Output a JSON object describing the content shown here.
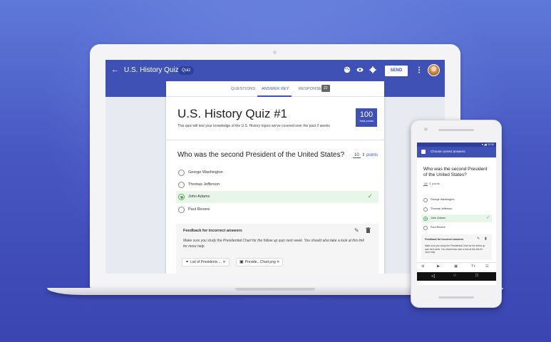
{
  "appbar": {
    "back_icon": "←",
    "title": "U.S. History Quiz #1",
    "chip": "Quiz",
    "send_label": "SEND",
    "icons": [
      "palette-icon",
      "eye-icon",
      "gear-icon",
      "more-vert-icon"
    ]
  },
  "tabs": {
    "questions": "QUESTIONS",
    "answer_key": "ANSWER KEY",
    "responses": "RESPONSES",
    "responses_count": "22"
  },
  "quiz": {
    "title": "U.S. History Quiz #1",
    "description": "This quiz will test your knowledge of the U.S. History topics we've covered over the past 2 weeks",
    "total_points": "100",
    "total_points_label": "Total points"
  },
  "question": {
    "text": "Who was the second President of the United States?",
    "points_value": "10",
    "points_label": "points",
    "options": [
      {
        "label": "George Washington",
        "selected": false
      },
      {
        "label": "Thomas Jefferson",
        "selected": false
      },
      {
        "label": "John Adams",
        "selected": true
      },
      {
        "label": "Paul Revere",
        "selected": false
      }
    ]
  },
  "feedback": {
    "title": "Feedback for incorrect answers",
    "text": "Make sure you study the Presidential Chart for the follow up quiz next week. You should also take a look at this link for more help.",
    "chips": [
      {
        "icon": "link-icon",
        "label": "List of Presidents ..."
      },
      {
        "icon": "image-icon",
        "label": "Preside...Chart.png"
      }
    ]
  },
  "phone": {
    "status_time": "12:30",
    "bar_title": "Choose correct answers",
    "question_text": "Who was the second President of the United States?",
    "points_value": "10",
    "points_label": "points",
    "options": [
      {
        "label": "George Washington",
        "selected": false
      },
      {
        "label": "Thomas Jefferson",
        "selected": false
      },
      {
        "label": "John Adams",
        "selected": true
      },
      {
        "label": "Paul Revere",
        "selected": false
      }
    ],
    "feedback_title": "Feedback for incorrect answers",
    "feedback_text": "Make sure you study the Presidential Chart for the follow up quiz next week. You should also take a look at this link for more help."
  }
}
